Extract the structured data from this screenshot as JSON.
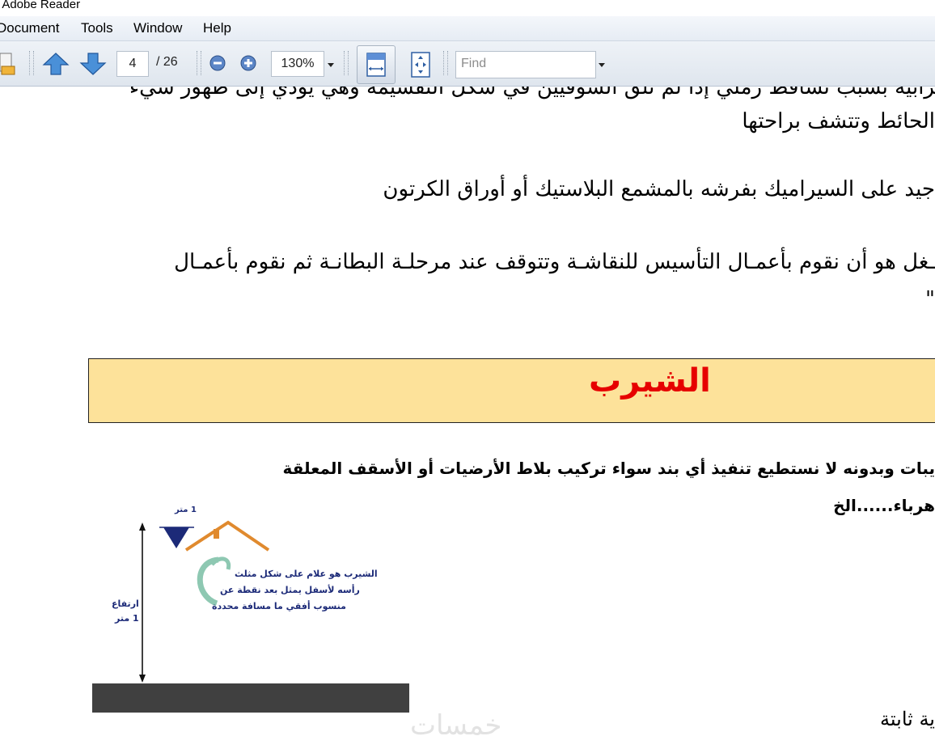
{
  "window": {
    "title": "- Adobe Reader"
  },
  "menu": [
    "Document",
    "Tools",
    "Window",
    "Help"
  ],
  "toolbar": {
    "current_page": "4",
    "total_pages": "/ 26",
    "zoom": "130%",
    "find_placeholder": "Find"
  },
  "document": {
    "cut_line": "ترابيه بسبب تساقط رملي إذا لم تلق السوقيين في شكل التقسيمة وهي يؤدي إلى ظهور شيء",
    "para1": "الحائط وتتشف براحتها",
    "para2": "جيد على السيراميك بفرشه بالمشمع البلاستيك أو أوراق الكرتون",
    "para3": "ـغل هو أن نقوم بأعمـال التأسيس للنقاشـة وتتوقف عند مرحلـة البطانـة ثم نقوم بأعمـال",
    "para3_end": "\"",
    "heading": "الشيرب",
    "bold1": "يبات وبدونه لا نستطيع تنفيذ أي بند سواء تركيب بلاط الأرضيات أو الأسقف المعلقة",
    "bold2": "هرباء......الخ",
    "figure": {
      "top_label": "1 متر",
      "side_label_1": "ارتفاع",
      "side_label_2": "1 متر",
      "caption_1": "الشيرب  هو علام على شكل مثلث",
      "caption_2": "رأسه لأسفل يمثل بعد  نقطة عن",
      "caption_3": "منسوب أفقي ما مسافة محددة"
    },
    "last_line": "ية ثابتة",
    "watermark": "خمسات"
  }
}
